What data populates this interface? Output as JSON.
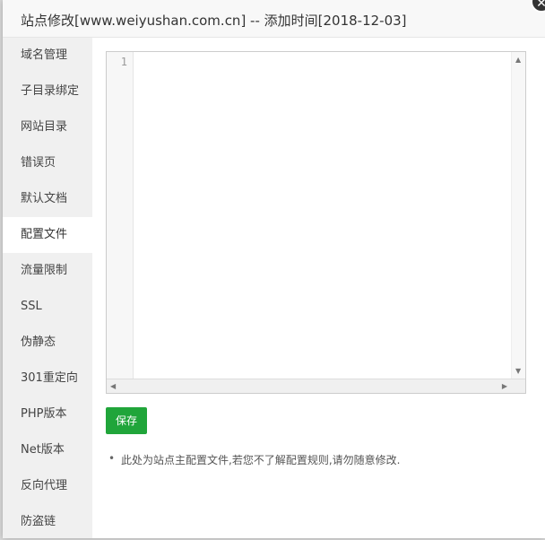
{
  "dialog": {
    "title": "站点修改[www.weiyushan.com.cn] -- 添加时间[2018-12-03]",
    "close_glyph": "✕"
  },
  "sidebar": {
    "items": [
      {
        "label": "域名管理"
      },
      {
        "label": "子目录绑定"
      },
      {
        "label": "网站目录"
      },
      {
        "label": "错误页"
      },
      {
        "label": "默认文档"
      },
      {
        "label": "配置文件",
        "active": true
      },
      {
        "label": "流量限制"
      },
      {
        "label": "SSL"
      },
      {
        "label": "伪静态"
      },
      {
        "label": "301重定向"
      },
      {
        "label": "PHP版本"
      },
      {
        "label": "Net版本"
      },
      {
        "label": "反向代理"
      },
      {
        "label": "防盗链"
      }
    ]
  },
  "editor": {
    "line_number": "1",
    "content": ""
  },
  "actions": {
    "save_label": "保存"
  },
  "tips": {
    "item": "此处为站点主配置文件,若您不了解配置规则,请勿随意修改."
  },
  "colors": {
    "accent": "#20a53a",
    "sidebar_bg": "#f0f0f0"
  }
}
